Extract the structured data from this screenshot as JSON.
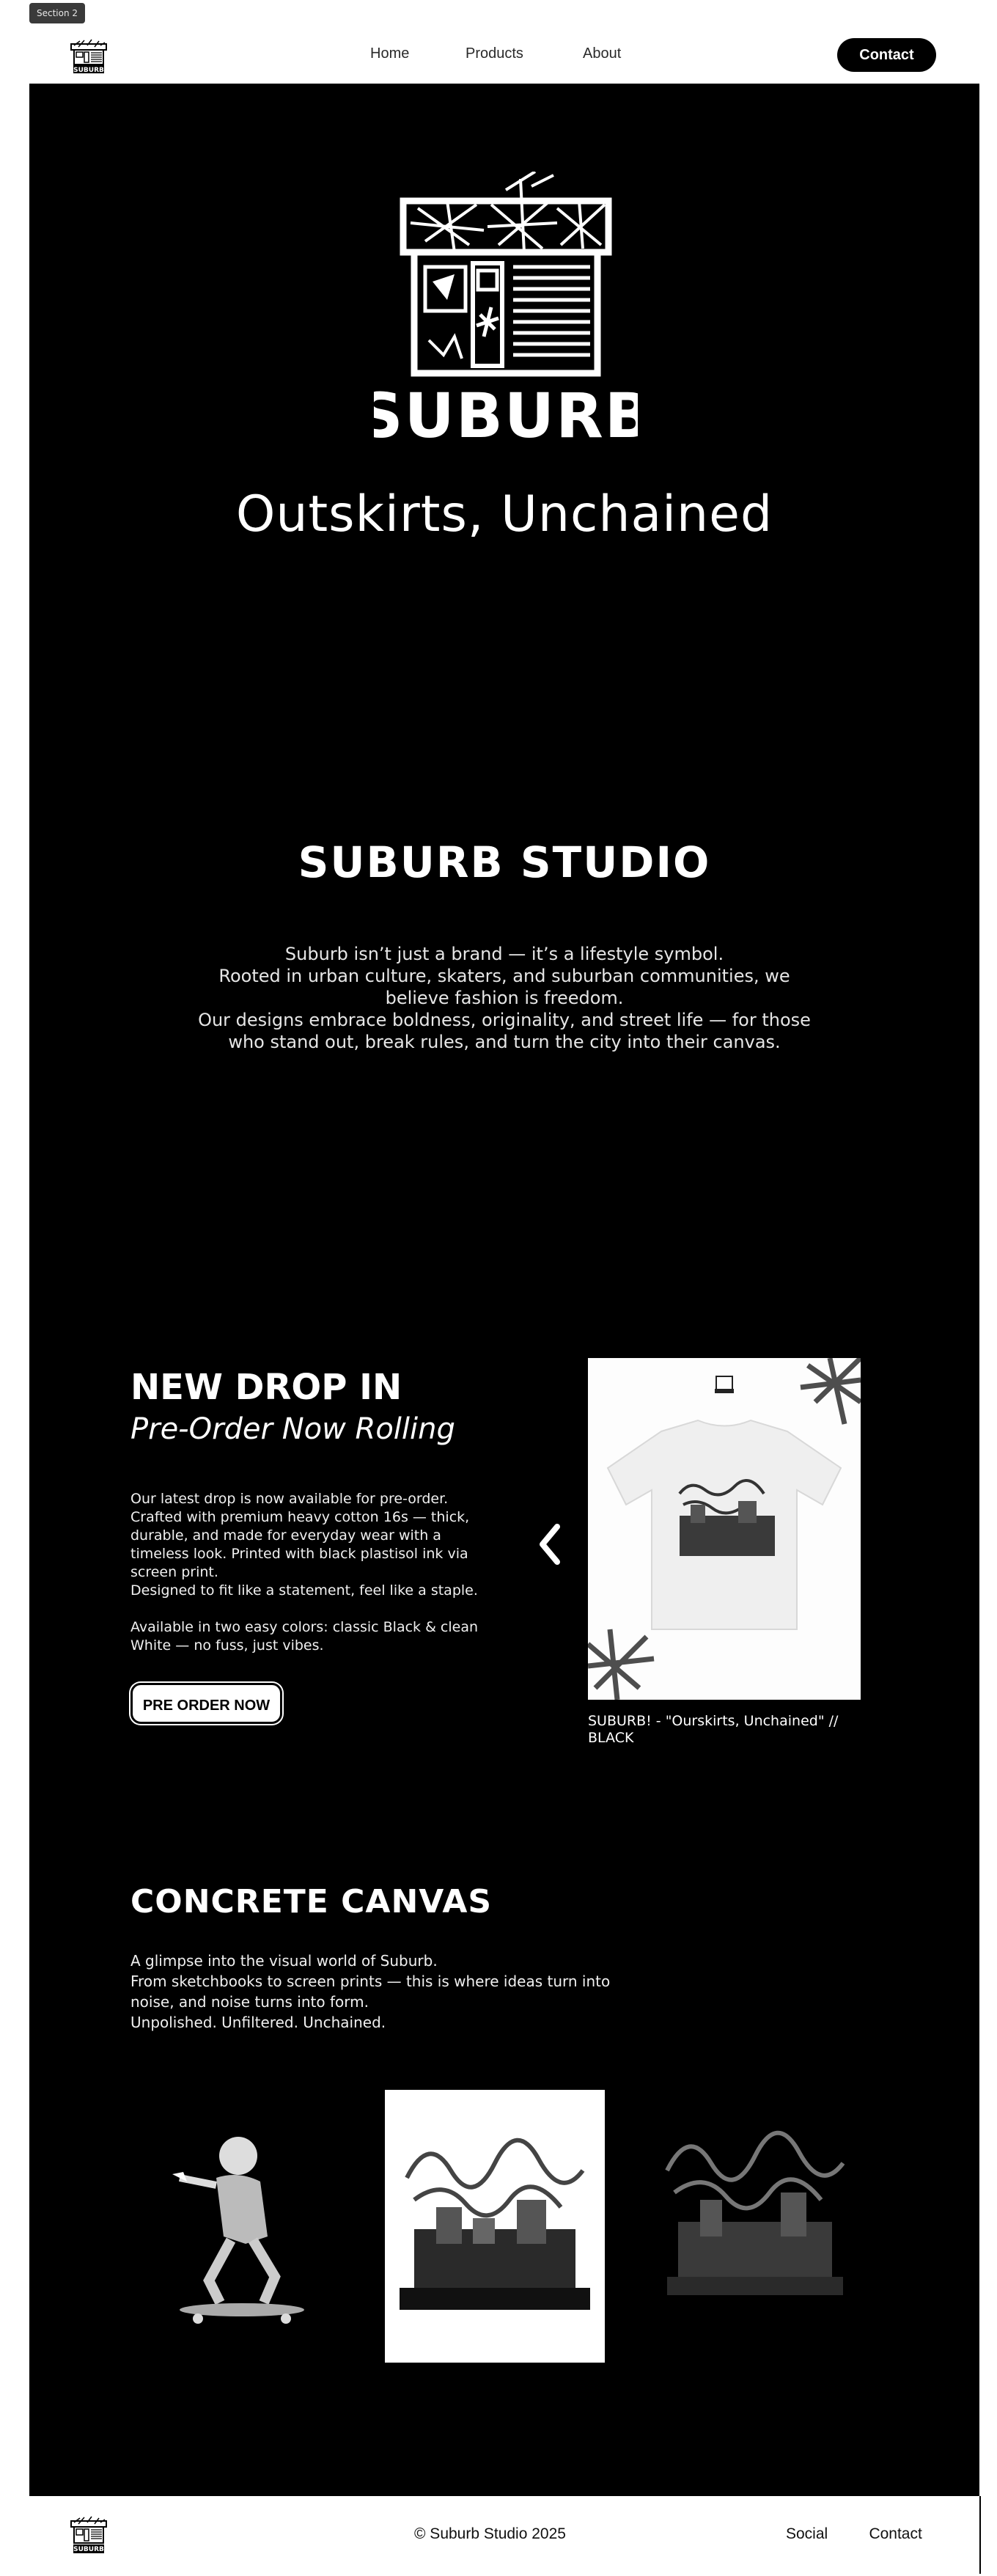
{
  "section_tag": "Section 2",
  "nav": {
    "links": [
      "Home",
      "Products",
      "About"
    ],
    "contact": "Contact"
  },
  "hero": {
    "logo_text": "SUBURB",
    "tagline": "Outskirts, Unchained"
  },
  "studio": {
    "title": "SUBURB STUDIO",
    "lines": [
      "Suburb isn’t just a brand — it’s a lifestyle symbol.",
      "Rooted in urban culture, skaters, and suburban communities, we",
      "believe fashion is freedom.",
      "Our designs embrace boldness, originality, and street life — for those",
      "who stand out, break rules, and turn the city into their canvas."
    ]
  },
  "drop": {
    "title": "NEW DROP IN",
    "subtitle": "Pre-Order Now Rolling",
    "paragraph1": [
      "Our latest drop is now available for pre-order.",
      "Crafted with premium heavy cotton 16s — thick,",
      "durable, and made for everyday wear with a",
      "timeless look. Printed with black plastisol ink via",
      "screen print.",
      "Designed to fit like a statement, feel like a staple."
    ],
    "paragraph2": [
      "Available in two easy colors: classic Black & clean",
      "White — no fuss, just vibes."
    ],
    "button": "PRE ORDER NOW",
    "product_caption": "SUBURB! - \"Ourskirts, Unchained\" // BLACK"
  },
  "canvas": {
    "title": "CONCRETE CANVAS",
    "lines": [
      "A glimpse into the visual world of Suburb.",
      "From sketchbooks to screen prints — this is where ideas turn into",
      "noise, and noise turns into form.",
      "Unpolished. Unfiltered. Unchained."
    ]
  },
  "footer": {
    "copyright": "© Suburb Studio 2025",
    "links": [
      "Social",
      "Contact"
    ]
  },
  "icons": {
    "carousel_prev": "chevron-left-icon"
  }
}
